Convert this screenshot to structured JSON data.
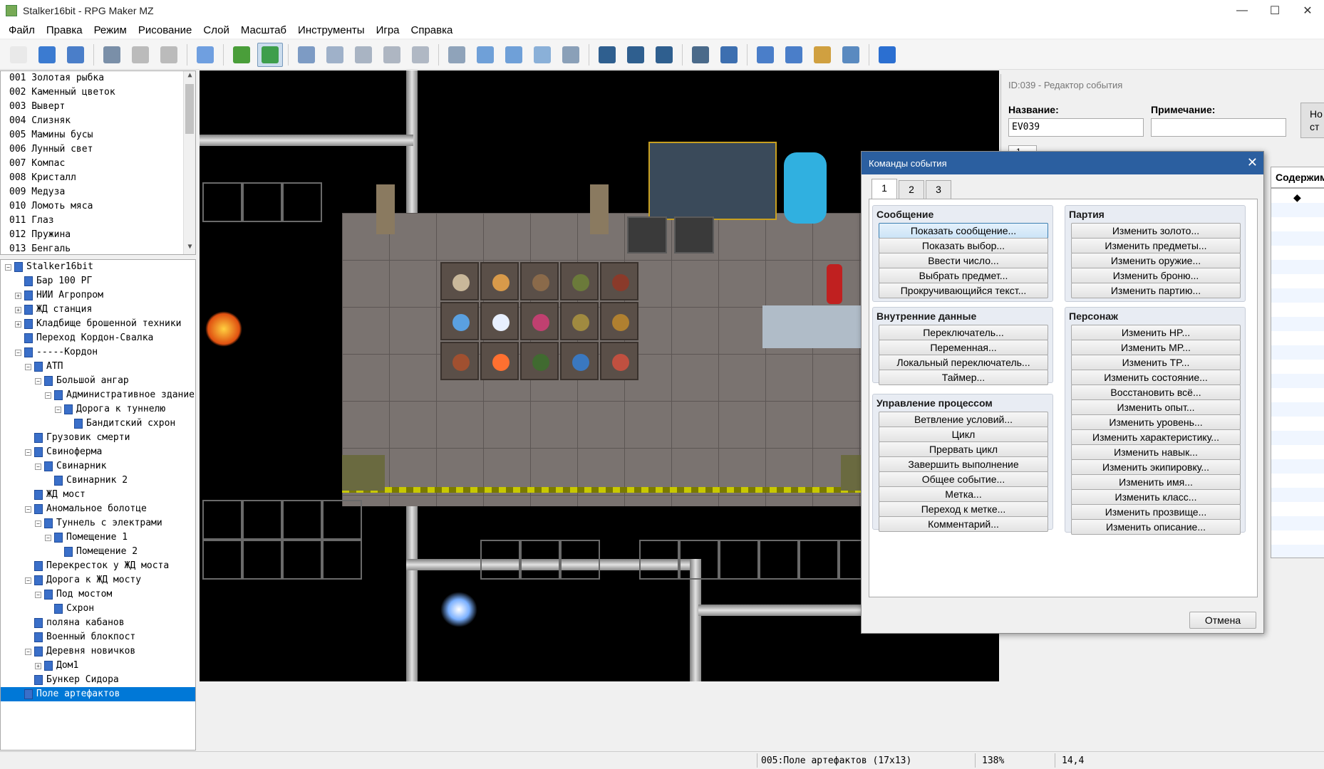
{
  "window": {
    "title": "Stalker16bit - RPG Maker MZ",
    "minimize": "—",
    "maximize": "☐",
    "close": "✕"
  },
  "menu": [
    "Файл",
    "Правка",
    "Режим",
    "Рисование",
    "Слой",
    "Масштаб",
    "Инструменты",
    "Игра",
    "Справка"
  ],
  "toolbar": [
    {
      "icon": "new-project-icon",
      "color": "#e9e9e9"
    },
    {
      "icon": "open-project-icon",
      "color": "#3b7bd1"
    },
    {
      "icon": "save-project-icon",
      "color": "#4a7ec9"
    },
    {
      "sep": true
    },
    {
      "icon": "cut-icon",
      "color": "#7a8fa8"
    },
    {
      "icon": "copy-icon",
      "color": "#bbbbbb"
    },
    {
      "icon": "paste-icon",
      "color": "#bbbbbb"
    },
    {
      "sep": true
    },
    {
      "icon": "undo-icon",
      "color": "#6f9fe0"
    },
    {
      "sep": true
    },
    {
      "icon": "map-mode-icon",
      "color": "#4a9e3a"
    },
    {
      "icon": "event-mode-icon",
      "color": "#3e9e4c",
      "active": true
    },
    {
      "sep": true
    },
    {
      "icon": "layer-1-icon",
      "color": "#7d9bc4"
    },
    {
      "icon": "layer-2-icon",
      "color": "#9fb1c9"
    },
    {
      "icon": "layer-3-icon",
      "color": "#a9b4c3"
    },
    {
      "icon": "layer-4-icon",
      "color": "#aeb6c2"
    },
    {
      "icon": "layer-auto-icon",
      "color": "#b0b8c4"
    },
    {
      "sep": true
    },
    {
      "icon": "pencil-icon",
      "color": "#8fa3ba"
    },
    {
      "icon": "rectangle-icon",
      "color": "#6fa0d8"
    },
    {
      "icon": "ellipse-icon",
      "color": "#6fa0d8"
    },
    {
      "icon": "fill-icon",
      "color": "#8ab0d8"
    },
    {
      "icon": "shadow-pen-icon",
      "color": "#8aa0b8"
    },
    {
      "sep": true
    },
    {
      "icon": "zoom-in-icon",
      "color": "#2f5f8f"
    },
    {
      "icon": "zoom-out-icon",
      "color": "#2f5f8f"
    },
    {
      "icon": "zoom-actual-icon",
      "color": "#2f5f8f"
    },
    {
      "sep": true
    },
    {
      "icon": "database-icon",
      "color": "#4a6a8a"
    },
    {
      "icon": "plugin-manager-icon",
      "color": "#3d6fb0"
    },
    {
      "sep": true
    },
    {
      "icon": "sound-test-icon",
      "color": "#4a7ec9"
    },
    {
      "icon": "event-searcher-icon",
      "color": "#4a7ec9"
    },
    {
      "icon": "resource-manager-icon",
      "color": "#d0a040"
    },
    {
      "icon": "character-generator-icon",
      "color": "#5a8ac0"
    },
    {
      "sep": true
    },
    {
      "icon": "playtest-icon",
      "color": "#2b6fd1"
    }
  ],
  "tile_list": [
    "001 Золотая рыбка",
    "002 Каменный цветок",
    "003 Выверт",
    "004 Слизняк",
    "005 Мамины бусы",
    "006 Лунный свет",
    "007 Компас",
    "008 Кристалл",
    "009 Медуза",
    "010 Ломоть мяса",
    "011 Глаз",
    "012 Пружина",
    "013 Бенгаль"
  ],
  "map_tree": [
    {
      "label": "Stalker16bit",
      "depth": 0,
      "exp": "−",
      "root": true
    },
    {
      "label": "Бар 100 РГ",
      "depth": 1,
      "exp": ""
    },
    {
      "label": "НИИ Агропром",
      "depth": 1,
      "exp": "+"
    },
    {
      "label": "ЖД станция",
      "depth": 1,
      "exp": "+"
    },
    {
      "label": "Кладбище брошенной техники",
      "depth": 1,
      "exp": "+"
    },
    {
      "label": "Переход Кордон-Свалка",
      "depth": 1,
      "exp": ""
    },
    {
      "label": "-----Кордон",
      "depth": 1,
      "exp": "−"
    },
    {
      "label": "АТП",
      "depth": 2,
      "exp": "−"
    },
    {
      "label": "Большой ангар",
      "depth": 3,
      "exp": "−"
    },
    {
      "label": "Административное здание",
      "depth": 4,
      "exp": "−"
    },
    {
      "label": "Дорога к туннелю",
      "depth": 5,
      "exp": "−"
    },
    {
      "label": "Бандитский схрон",
      "depth": 6,
      "exp": ""
    },
    {
      "label": "Грузовик смерти",
      "depth": 2,
      "exp": ""
    },
    {
      "label": "Свиноферма",
      "depth": 2,
      "exp": "−"
    },
    {
      "label": "Свинарник",
      "depth": 3,
      "exp": "−"
    },
    {
      "label": "Свинарник 2",
      "depth": 4,
      "exp": ""
    },
    {
      "label": "ЖД мост",
      "depth": 2,
      "exp": ""
    },
    {
      "label": "Аномальное болотце",
      "depth": 2,
      "exp": "−"
    },
    {
      "label": "Туннель с электрами",
      "depth": 3,
      "exp": "−"
    },
    {
      "label": "Помещение 1",
      "depth": 4,
      "exp": "−"
    },
    {
      "label": "Помещение 2",
      "depth": 5,
      "exp": ""
    },
    {
      "label": "Перекресток у ЖД моста",
      "depth": 2,
      "exp": ""
    },
    {
      "label": "Дорога к ЖД мосту",
      "depth": 2,
      "exp": "−"
    },
    {
      "label": "Под мостом",
      "depth": 3,
      "exp": "−"
    },
    {
      "label": "Схрон",
      "depth": 4,
      "exp": ""
    },
    {
      "label": "поляна кабанов",
      "depth": 2,
      "exp": ""
    },
    {
      "label": "Военный блокпост",
      "depth": 2,
      "exp": ""
    },
    {
      "label": "Деревня новичков",
      "depth": 2,
      "exp": "−"
    },
    {
      "label": "Дом1",
      "depth": 3,
      "exp": "+"
    },
    {
      "label": "Бункер Сидора",
      "depth": 2,
      "exp": ""
    },
    {
      "label": "Поле артефактов",
      "depth": 1,
      "exp": "",
      "selected": true
    }
  ],
  "event_editor": {
    "caption": "ID:039 - Редактор события",
    "name_label": "Название:",
    "name_value": "EV039",
    "note_label": "Примечание:",
    "note_value": "",
    "side_button": "Но ст",
    "page_tab": "1",
    "contents_header": "Содержим",
    "contents_bullet": "◆"
  },
  "event_commands": {
    "title": "Команды события",
    "close": "✕",
    "tabs": [
      "1",
      "2",
      "3"
    ],
    "groups": {
      "message": {
        "title": "Сообщение",
        "items": [
          "Показать сообщение...",
          "Показать выбор...",
          "Ввести число...",
          "Выбрать предмет...",
          "Прокручивающийся текст..."
        ]
      },
      "game_progression": {
        "title": "Внутренние данные",
        "items": [
          "Переключатель...",
          "Переменная...",
          "Локальный переключатель...",
          "Таймер..."
        ]
      },
      "flow_control": {
        "title": "Управление процессом",
        "items": [
          "Ветвление условий...",
          "Цикл",
          "Прервать цикл",
          "Завершить выполнение",
          "Общее событие...",
          "Метка...",
          "Переход к метке...",
          "Комментарий..."
        ]
      },
      "party": {
        "title": "Партия",
        "items": [
          "Изменить золото...",
          "Изменить предметы...",
          "Изменить оружие...",
          "Изменить броню...",
          "Изменить партию..."
        ]
      },
      "actor": {
        "title": "Персонаж",
        "items": [
          "Изменить HP...",
          "Изменить MP...",
          "Изменить TP...",
          "Изменить состояние...",
          "Восстановить всё...",
          "Изменить опыт...",
          "Изменить уровень...",
          "Изменить характеристику...",
          "Изменить навык...",
          "Изменить экипировку...",
          "Изменить имя...",
          "Изменить класс...",
          "Изменить прозвище...",
          "Изменить описание..."
        ]
      }
    },
    "cancel": "Отмена"
  },
  "status": {
    "map": "005:Поле артефактов (17x13)",
    "zoom": "138%",
    "coords": "14,4"
  },
  "artifact_colors": [
    "#c9b89a",
    "#d89a4a",
    "#8a6a4a",
    "#6b7a3a",
    "#8a3a2a",
    "#5aa0e0",
    "#e8f0ff",
    "#c04070",
    "#a08a40",
    "#b08030",
    "#a05030",
    "#ff7030",
    "#406a30",
    "#3a78c0",
    "#c05040"
  ]
}
